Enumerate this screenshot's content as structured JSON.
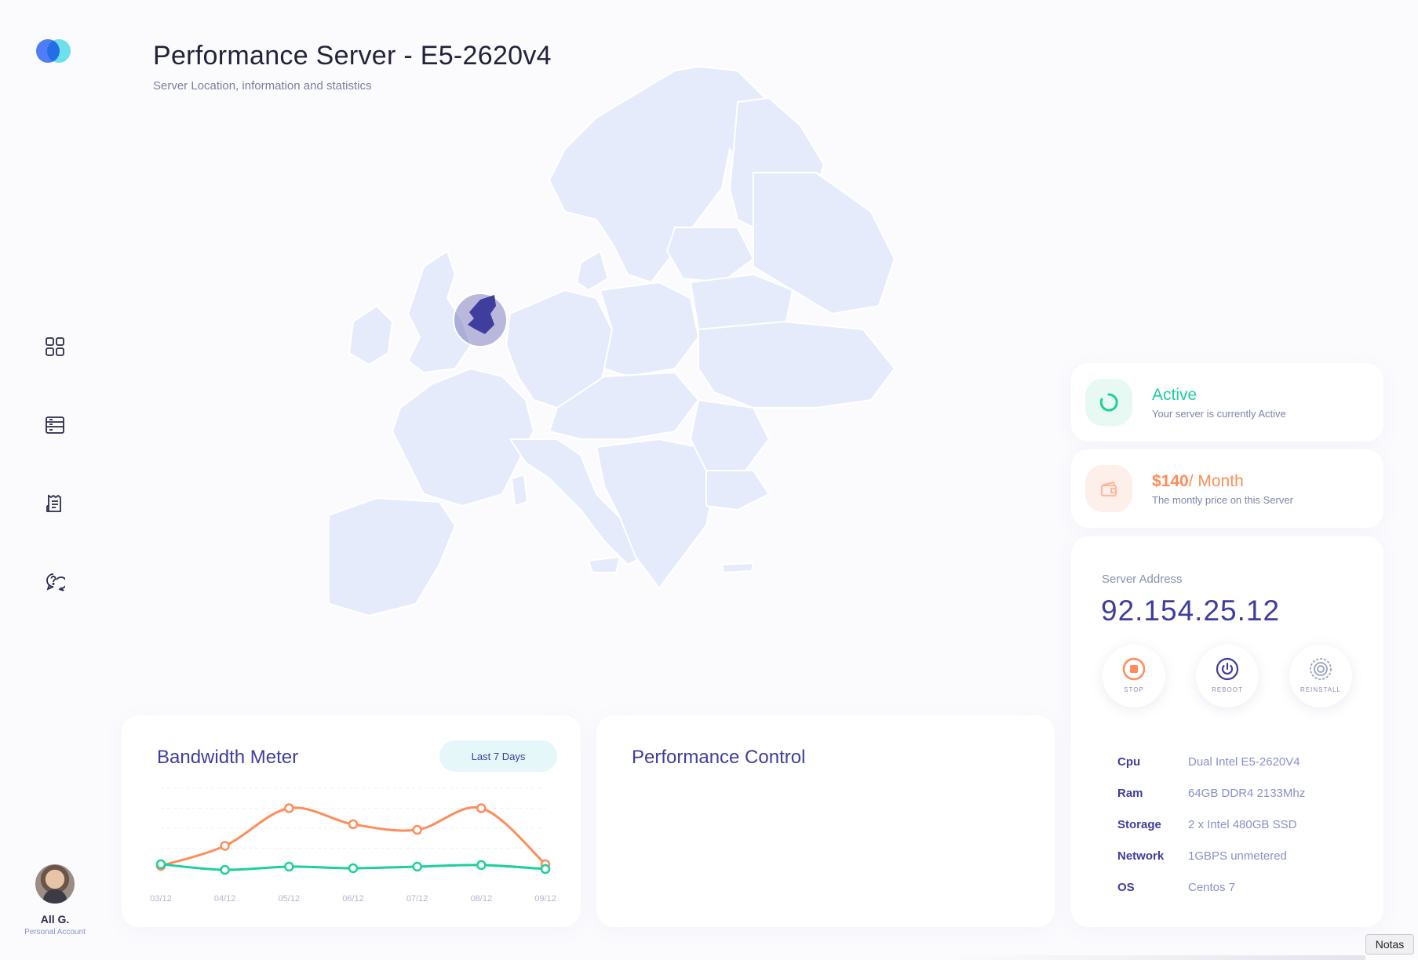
{
  "sidebar": {
    "nav_icons": [
      "dashboard-icon",
      "server-icon",
      "receipt-icon",
      "support-chat-icon"
    ],
    "user": {
      "name": "All G.",
      "role": "Personal Account"
    }
  },
  "header": {
    "title": "Performance Server - E5-2620v4",
    "subtitle": "Server Location, information and statistics"
  },
  "map": {
    "highlighted_country": "Netherlands",
    "accent": "#3f3d9e",
    "land": "#e6ebfb"
  },
  "status": {
    "title": "Active",
    "description": "Your server is currently Active",
    "color": "#1ecf9c"
  },
  "price": {
    "amount": "$140",
    "period": "/ Month",
    "description": "The montly price on this Server",
    "color": "#ff8c5a"
  },
  "server": {
    "address_label": "Server Address",
    "address": "92.154.25.12",
    "controls": {
      "stop": "STOP",
      "reboot": "REBOOT",
      "reinstall": "REINSTALL"
    },
    "specs": [
      {
        "key": "Cpu",
        "value": "Dual Intel E5-2620V4"
      },
      {
        "key": "Ram",
        "value": "64GB DDR4 2133Mhz"
      },
      {
        "key": "Storage",
        "value": "2 x Intel 480GB SSD"
      },
      {
        "key": "Network",
        "value": "1GBPS unmetered"
      },
      {
        "key": "OS",
        "value": "Centos 7"
      }
    ]
  },
  "bandwidth": {
    "title": "Bandwidth Meter",
    "range_button": "Last 7 Days"
  },
  "performance": {
    "title": "Performance Control"
  },
  "chart_data": {
    "type": "line",
    "x": [
      "03/12",
      "04/12",
      "05/12",
      "06/12",
      "07/12",
      "08/12",
      "09/12"
    ],
    "ylim": [
      0,
      100
    ],
    "series": [
      {
        "color": "#ff8c5a",
        "values": [
          3,
          28,
          75,
          55,
          48,
          75,
          5
        ]
      },
      {
        "color": "#1ecf9c",
        "values": [
          5,
          -2,
          2,
          0,
          2,
          4,
          -1
        ]
      }
    ],
    "grid": true
  },
  "notas": "Notas"
}
